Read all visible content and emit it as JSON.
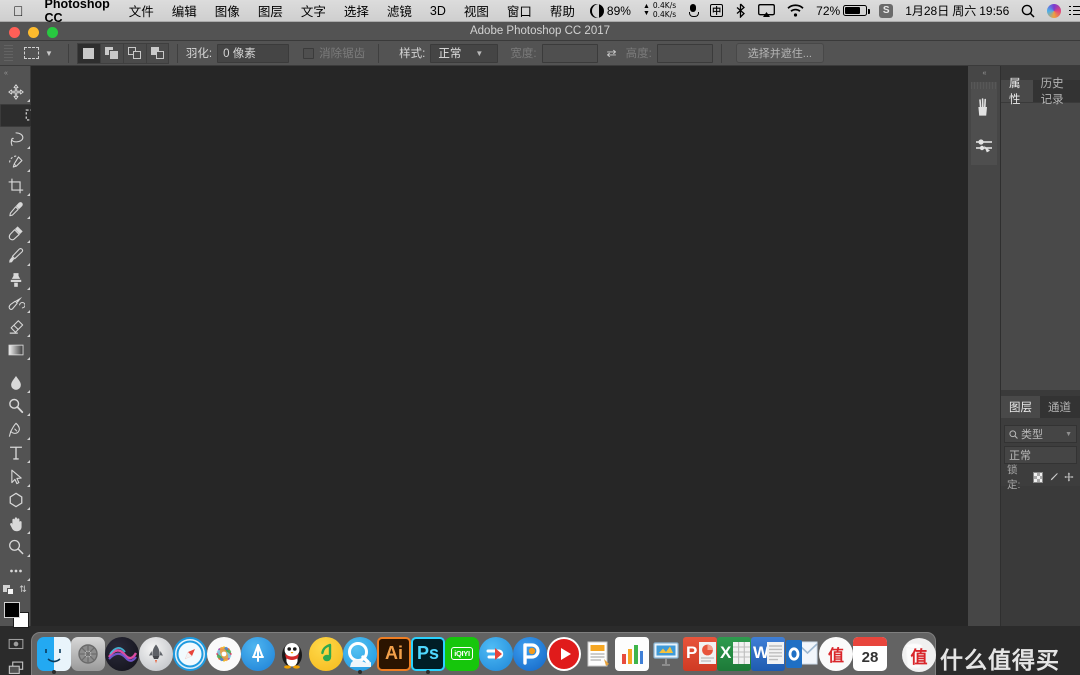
{
  "menubar": {
    "apple_icon": "apple-logo",
    "app_name": "Photoshop CC",
    "items": [
      "文件",
      "编辑",
      "图像",
      "图层",
      "文字",
      "选择",
      "滤镜",
      "3D",
      "视图",
      "窗口",
      "帮助"
    ],
    "status": {
      "cpu_percent": "89%",
      "net_up": "0.4K/s",
      "net_down": "0.4K/s",
      "input_method": "中",
      "battery_percent": "72%",
      "sync_letter": "S",
      "date": "1月28日",
      "weekday": "周六",
      "time": "19:56"
    }
  },
  "window": {
    "title": "Adobe Photoshop CC 2017"
  },
  "options_bar": {
    "tool_icon": "rectangular-marquee-icon",
    "selection_modes": [
      "new-selection",
      "add-to-selection",
      "subtract-from-selection",
      "intersect-selection"
    ],
    "feather_label": "羽化:",
    "feather_value": "0 像素",
    "antialias_label": "消除锯齿",
    "style_label": "样式:",
    "style_value": "正常",
    "width_label": "宽度:",
    "width_value": "",
    "swap_icon": "swap-dimensions-icon",
    "height_label": "高度:",
    "height_value": "",
    "select_and_mask": "选择并遮住..."
  },
  "toolbar": {
    "collapse_icon": "collapse-panel-icon",
    "tools": [
      {
        "name": "move-tool",
        "icon": "move-icon",
        "selected": false
      },
      {
        "name": "rectangular-marquee-tool",
        "icon": "marquee-icon",
        "selected": true
      },
      {
        "name": "lasso-tool",
        "icon": "lasso-icon",
        "selected": false
      },
      {
        "name": "quick-selection-tool",
        "icon": "quick-select-icon",
        "selected": false
      },
      {
        "name": "crop-tool",
        "icon": "crop-icon",
        "selected": false
      },
      {
        "name": "eyedropper-tool",
        "icon": "eyedropper-icon",
        "selected": false
      },
      {
        "name": "spot-healing-brush-tool",
        "icon": "healing-brush-icon",
        "selected": false
      },
      {
        "name": "brush-tool",
        "icon": "brush-icon",
        "selected": false
      },
      {
        "name": "clone-stamp-tool",
        "icon": "clone-stamp-icon",
        "selected": false
      },
      {
        "name": "history-brush-tool",
        "icon": "history-brush-icon",
        "selected": false
      },
      {
        "name": "eraser-tool",
        "icon": "eraser-icon",
        "selected": false
      },
      {
        "name": "gradient-tool",
        "icon": "gradient-icon",
        "selected": false
      },
      {
        "name": "blur-tool",
        "icon": "blur-drop-icon",
        "selected": false
      },
      {
        "name": "dodge-tool",
        "icon": "dodge-icon",
        "selected": false
      },
      {
        "name": "pen-tool",
        "icon": "pen-icon",
        "selected": false
      },
      {
        "name": "type-tool",
        "icon": "type-T-icon",
        "selected": false
      },
      {
        "name": "path-selection-tool",
        "icon": "path-arrow-icon",
        "selected": false
      },
      {
        "name": "shape-tool",
        "icon": "polygon-shape-icon",
        "selected": false
      },
      {
        "name": "hand-tool",
        "icon": "hand-icon",
        "selected": false
      },
      {
        "name": "zoom-tool",
        "icon": "magnifier-icon",
        "selected": false
      },
      {
        "name": "edit-toolbar-tool",
        "icon": "ellipsis-icon",
        "selected": false
      }
    ],
    "foreground_color": "#000000",
    "background_color": "#ffffff",
    "quick_mask_icon": "quick-mask-icon",
    "screen_mode_icon": "screen-mode-icon"
  },
  "right_panels": {
    "collapse_icon": "collapse-panels-icon",
    "icon_dock": [
      {
        "name": "brush-presets-icon"
      },
      {
        "name": "brush-settings-icon"
      }
    ],
    "top_panel": {
      "tabs": [
        {
          "label": "属性",
          "active": true
        },
        {
          "label": "历史记录",
          "active": false
        }
      ]
    },
    "layers_panel": {
      "tabs": [
        {
          "label": "图层",
          "active": true
        },
        {
          "label": "通道",
          "active": false
        }
      ],
      "filter_icon": "search-icon",
      "filter_value": "类型",
      "blend_mode": "正常",
      "lock_label": "锁定:",
      "lock_icons": [
        "lock-transparent-pixels-icon",
        "lock-image-pixels-icon",
        "lock-position-icon"
      ]
    }
  },
  "dock": {
    "items": [
      {
        "name": "finder",
        "label": "",
        "running": true
      },
      {
        "name": "system-preferences",
        "label": "",
        "running": false
      },
      {
        "name": "siri",
        "label": "",
        "running": false
      },
      {
        "name": "launchpad",
        "label": "",
        "running": false
      },
      {
        "name": "safari",
        "label": "",
        "running": false
      },
      {
        "name": "photos",
        "label": "",
        "running": false
      },
      {
        "name": "app-store",
        "label": "",
        "running": false
      },
      {
        "name": "qq",
        "label": "",
        "running": false
      },
      {
        "name": "qq-music",
        "label": "",
        "running": false
      },
      {
        "name": "qq-browser",
        "label": "",
        "running": true
      },
      {
        "name": "illustrator",
        "label": "Ai",
        "running": false
      },
      {
        "name": "photoshop",
        "label": "Ps",
        "running": true
      },
      {
        "name": "iqiyi",
        "label": "iQIYI",
        "running": false
      },
      {
        "name": "thunder",
        "label": "",
        "running": false
      },
      {
        "name": "pptv",
        "label": "",
        "running": false
      },
      {
        "name": "video-player",
        "label": "",
        "running": false
      },
      {
        "name": "pages",
        "label": "",
        "running": false
      },
      {
        "name": "numbers",
        "label": "",
        "running": false
      },
      {
        "name": "keynote",
        "label": "",
        "running": false
      },
      {
        "name": "powerpoint",
        "label": "P",
        "running": false
      },
      {
        "name": "excel",
        "label": "X",
        "running": false
      },
      {
        "name": "word",
        "label": "W",
        "running": false
      },
      {
        "name": "outlook",
        "label": "O",
        "running": false
      },
      {
        "name": "smzdm",
        "label": "值",
        "running": false
      },
      {
        "name": "calendar",
        "label": "28",
        "running": false
      }
    ],
    "trash_name": "trash"
  },
  "watermark": {
    "badge": "值",
    "text": "什么值得买"
  }
}
